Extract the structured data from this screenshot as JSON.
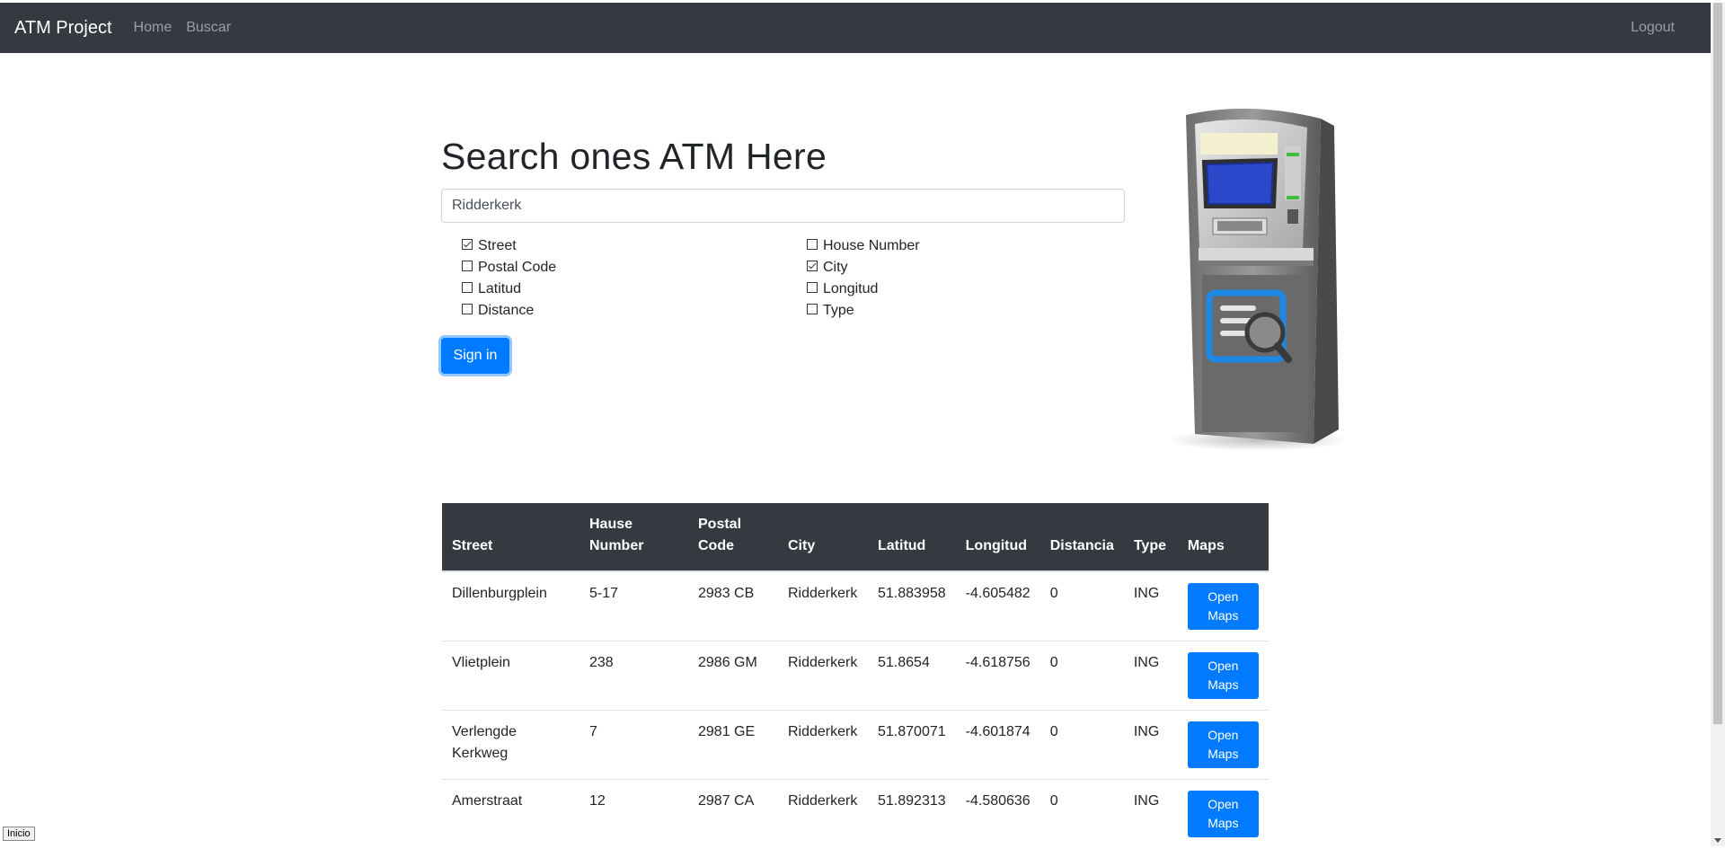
{
  "nav": {
    "brand": "ATM Project",
    "home": "Home",
    "search": "Buscar",
    "logout": "Logout"
  },
  "search": {
    "title": "Search ones ATM Here",
    "query": "Ridderkerk",
    "filters": [
      {
        "label": "Street",
        "checked": true
      },
      {
        "label": "House Number",
        "checked": false
      },
      {
        "label": "Postal Code",
        "checked": false
      },
      {
        "label": "City",
        "checked": true
      },
      {
        "label": "Latitud",
        "checked": false
      },
      {
        "label": "Longitud",
        "checked": false
      },
      {
        "label": "Distance",
        "checked": false
      },
      {
        "label": "Type",
        "checked": false
      }
    ],
    "submit_label": "Sign in"
  },
  "image": {
    "icon": "atm-machine-icon"
  },
  "results": {
    "headers": [
      "Street",
      "Hause Number",
      "Postal Code",
      "City",
      "Latitud",
      "Longitud",
      "Distancia",
      "Type",
      "Maps"
    ],
    "rows": [
      {
        "street": "Dillenburgplein",
        "number": "5-17",
        "postal": "2983 CB",
        "city": "Ridderkerk",
        "lat": "51.883958",
        "lng": "-4.605482",
        "distance": "0",
        "type": "ING",
        "maps": "Open Maps"
      },
      {
        "street": "Vlietplein",
        "number": "238",
        "postal": "2986 GM",
        "city": "Ridderkerk",
        "lat": "51.8654",
        "lng": "-4.618756",
        "distance": "0",
        "type": "ING",
        "maps": "Open Maps"
      },
      {
        "street": "Verlengde Kerkweg",
        "number": "7",
        "postal": "2981 GE",
        "city": "Ridderkerk",
        "lat": "51.870071",
        "lng": "-4.601874",
        "distance": "0",
        "type": "ING",
        "maps": "Open Maps"
      },
      {
        "street": "Amerstraat",
        "number": "12",
        "postal": "2987 CA",
        "city": "Ridderkerk",
        "lat": "51.892313",
        "lng": "-4.580636",
        "distance": "0",
        "type": "ING",
        "maps": "Open Maps"
      }
    ]
  },
  "status_tooltip": "Inicio",
  "colors": {
    "navbar": "#343a40",
    "primary": "#007bff"
  }
}
